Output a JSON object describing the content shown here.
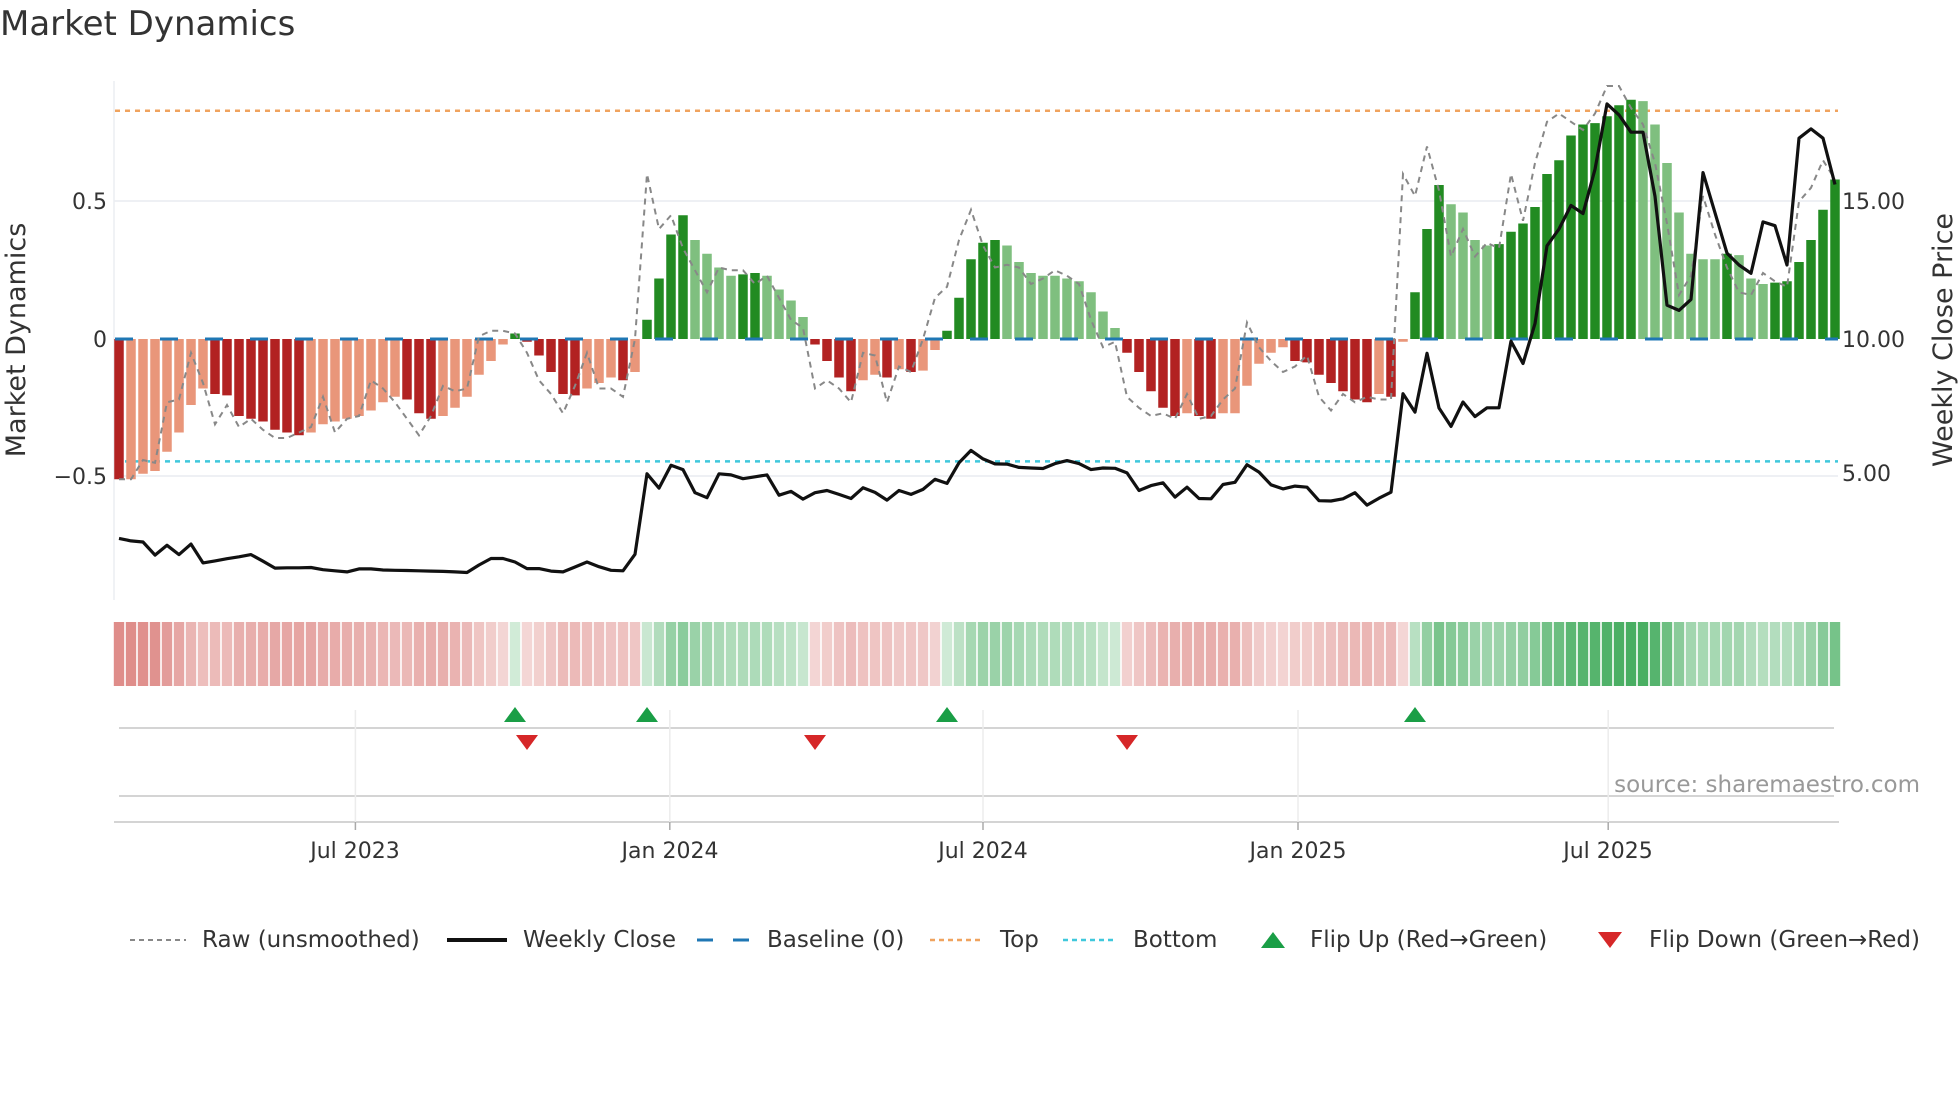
{
  "chart_data": {
    "type": "bar",
    "title": "Market Dynamics",
    "ylabel": "Market Dynamics",
    "y2label": "Weekly Close Price",
    "ylim": [
      -0.95,
      0.94
    ],
    "y2lim": [
      0.5,
      19.4
    ],
    "yticks": [
      {
        "value": 0.5,
        "label": "0.5"
      },
      {
        "value": 0,
        "label": "0"
      },
      {
        "value": -0.5,
        "label": "−0.5"
      }
    ],
    "y2ticks": [
      {
        "value": 15,
        "label": "15.00"
      },
      {
        "value": 10,
        "label": "10.00"
      },
      {
        "value": 5,
        "label": "5.00"
      }
    ],
    "xticks": [
      {
        "week": 20.7,
        "label": "Jul 2023"
      },
      {
        "week": 46.9,
        "label": "Jan 2024"
      },
      {
        "week": 73.0,
        "label": "Jul 2024"
      },
      {
        "week": 99.25,
        "label": "Jan 2025"
      },
      {
        "week": 125.1,
        "label": "Jul 2025"
      }
    ],
    "grid": true,
    "baseline": 0,
    "top_level": 0.83,
    "bottom_level": -0.445,
    "dynamics": [
      -0.51,
      -0.51,
      -0.49,
      -0.48,
      -0.41,
      -0.34,
      -0.24,
      -0.18,
      -0.2,
      -0.205,
      -0.28,
      -0.29,
      -0.3,
      -0.33,
      -0.34,
      -0.35,
      -0.34,
      -0.31,
      -0.3,
      -0.29,
      -0.28,
      -0.26,
      -0.23,
      -0.21,
      -0.22,
      -0.27,
      -0.29,
      -0.28,
      -0.25,
      -0.21,
      -0.13,
      -0.08,
      -0.02,
      0.02,
      -0.01,
      -0.06,
      -0.12,
      -0.2,
      -0.205,
      -0.18,
      -0.16,
      -0.14,
      -0.15,
      -0.12,
      0.07,
      0.22,
      0.38,
      0.45,
      0.36,
      0.31,
      0.26,
      0.23,
      0.235,
      0.24,
      0.23,
      0.18,
      0.14,
      0.08,
      -0.02,
      -0.08,
      -0.14,
      -0.19,
      -0.15,
      -0.13,
      -0.14,
      -0.11,
      -0.12,
      -0.115,
      -0.04,
      0.03,
      0.15,
      0.29,
      0.35,
      0.36,
      0.34,
      0.28,
      0.24,
      0.23,
      0.23,
      0.22,
      0.21,
      0.17,
      0.1,
      0.04,
      -0.05,
      -0.12,
      -0.19,
      -0.25,
      -0.28,
      -0.27,
      -0.28,
      -0.29,
      -0.27,
      -0.27,
      -0.17,
      -0.09,
      -0.05,
      -0.03,
      -0.08,
      -0.085,
      -0.13,
      -0.16,
      -0.19,
      -0.22,
      -0.23,
      -0.2,
      -0.21,
      -0.01,
      0.17,
      0.4,
      0.56,
      0.49,
      0.46,
      0.36,
      0.34,
      0.345,
      0.39,
      0.42,
      0.48,
      0.6,
      0.65,
      0.74,
      0.78,
      0.785,
      0.81,
      0.85,
      0.87,
      0.865,
      0.78,
      0.64,
      0.46,
      0.31,
      0.29,
      0.29,
      0.31,
      0.305,
      0.22,
      0.2,
      0.205,
      0.21,
      0.28,
      0.36,
      0.47,
      0.58
    ],
    "raw": [
      -0.51,
      -0.51,
      -0.44,
      -0.45,
      -0.23,
      -0.22,
      -0.05,
      -0.16,
      -0.31,
      -0.24,
      -0.32,
      -0.29,
      -0.33,
      -0.36,
      -0.36,
      -0.34,
      -0.32,
      -0.21,
      -0.34,
      -0.29,
      -0.28,
      -0.15,
      -0.18,
      -0.23,
      -0.29,
      -0.35,
      -0.28,
      -0.17,
      -0.19,
      -0.18,
      0.01,
      0.03,
      0.03,
      0.02,
      -0.05,
      -0.15,
      -0.2,
      -0.27,
      -0.17,
      -0.05,
      -0.18,
      -0.18,
      -0.21,
      0.0,
      0.6,
      0.4,
      0.45,
      0.33,
      0.25,
      0.17,
      0.26,
      0.25,
      0.25,
      0.2,
      0.23,
      0.15,
      0.07,
      0.04,
      -0.18,
      -0.15,
      -0.18,
      -0.23,
      -0.05,
      -0.06,
      -0.23,
      -0.1,
      -0.12,
      0.0,
      0.15,
      0.19,
      0.36,
      0.47,
      0.34,
      0.26,
      0.27,
      0.26,
      0.2,
      0.22,
      0.25,
      0.23,
      0.2,
      0.07,
      -0.03,
      -0.01,
      -0.21,
      -0.25,
      -0.28,
      -0.27,
      -0.29,
      -0.2,
      -0.29,
      -0.28,
      -0.22,
      -0.18,
      0.06,
      -0.03,
      -0.08,
      -0.12,
      -0.1,
      -0.06,
      -0.21,
      -0.26,
      -0.2,
      -0.23,
      -0.21,
      -0.22,
      -0.22,
      0.6,
      0.52,
      0.7,
      0.54,
      0.3,
      0.4,
      0.3,
      0.35,
      0.33,
      0.6,
      0.43,
      0.64,
      0.79,
      0.82,
      0.79,
      0.76,
      0.82,
      0.92,
      0.92,
      0.84,
      0.78,
      0.64,
      0.42,
      0.16,
      0.23,
      0.52,
      0.38,
      0.26,
      0.17,
      0.16,
      0.24,
      0.21,
      0.19,
      0.5,
      0.55,
      0.65,
      0.58
    ],
    "close": [
      2.75,
      2.66,
      2.62,
      2.14,
      2.5,
      2.16,
      2.54,
      1.86,
      1.93,
      2.01,
      2.08,
      2.16,
      1.92,
      1.67,
      1.68,
      1.68,
      1.69,
      1.61,
      1.57,
      1.53,
      1.64,
      1.64,
      1.6,
      1.59,
      1.58,
      1.57,
      1.56,
      1.55,
      1.53,
      1.51,
      1.78,
      2.02,
      2.02,
      1.89,
      1.65,
      1.65,
      1.56,
      1.53,
      1.71,
      1.89,
      1.72,
      1.59,
      1.57,
      2.17,
      5.1,
      4.58,
      5.41,
      5.25,
      4.41,
      4.23,
      5.1,
      5.06,
      4.92,
      4.99,
      5.06,
      4.32,
      4.46,
      4.18,
      4.41,
      4.49,
      4.35,
      4.2,
      4.59,
      4.42,
      4.14,
      4.49,
      4.35,
      4.53,
      4.9,
      4.75,
      5.5,
      5.95,
      5.64,
      5.46,
      5.45,
      5.33,
      5.31,
      5.29,
      5.47,
      5.58,
      5.47,
      5.25,
      5.31,
      5.3,
      5.13,
      4.49,
      4.67,
      4.77,
      4.25,
      4.61,
      4.2,
      4.19,
      4.71,
      4.79,
      5.43,
      5.16,
      4.7,
      4.55,
      4.65,
      4.61,
      4.12,
      4.11,
      4.19,
      4.41,
      3.96,
      4.21,
      4.43,
      8.01,
      7.34,
      9.48,
      7.49,
      6.82,
      7.71,
      7.18,
      7.5,
      7.5,
      9.92,
      9.11,
      10.56,
      13.39,
      14.0,
      14.86,
      14.56,
      16.17,
      18.55,
      18.15,
      17.52,
      17.52,
      15.19,
      11.23,
      11.04,
      11.44,
      16.05,
      14.59,
      13.12,
      12.69,
      12.39,
      14.26,
      14.12,
      12.69,
      17.3,
      17.64,
      17.3,
      15.62
    ],
    "flip_up_weeks": [
      34,
      45,
      70,
      109
    ],
    "flip_down_weeks": [
      35,
      59,
      85
    ],
    "legend": {
      "placement": "bottom",
      "raw": "Raw (unsmoothed)",
      "close": "Weekly Close",
      "baseline": "Baseline (0)",
      "top": "Top",
      "bottom": "Bottom",
      "flip_up": "Flip Up (Red→Green)",
      "flip_down": "Flip Down (Green→Red)"
    },
    "source": "source: sharemaestro.com"
  },
  "colors": {
    "bar_red_strong": "#b22222",
    "bar_red_weak": "#e9967a",
    "bar_green_strong": "#228b22",
    "bar_green_weak": "#7fbf7f",
    "raw_line": "#888888",
    "close_line": "#111111",
    "baseline": "#1f77b4",
    "top": "#f0a35e",
    "bottom": "#3fc8dc",
    "flip_up": "#1a9e46",
    "flip_down": "#d62728"
  }
}
